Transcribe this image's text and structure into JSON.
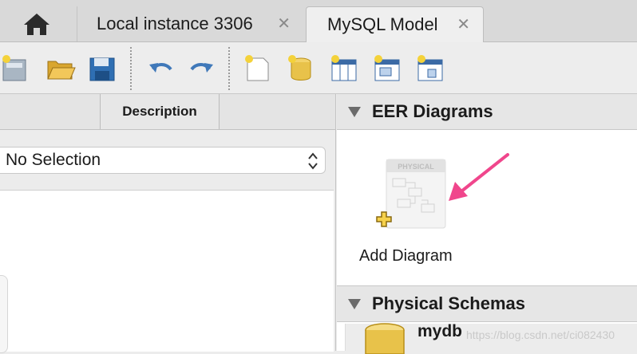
{
  "tabs": [
    {
      "label": "Local instance 3306",
      "close": "✕",
      "active": false
    },
    {
      "label": "MySQL Model",
      "close": "✕",
      "active": true
    }
  ],
  "toolbar": {
    "icons": [
      "new-model-icon",
      "open-model-icon",
      "save-model-icon",
      "undo-icon",
      "redo-icon",
      "new-document-icon",
      "new-schema-icon",
      "new-table-icon",
      "new-view-icon",
      "new-routine-icon"
    ]
  },
  "left_pane": {
    "column_header": "Description",
    "select_value": "No Selection"
  },
  "right_pane": {
    "eer_title": "EER Diagrams",
    "add_diagram_label": "Add Diagram",
    "diagram_badge": "PHYSICAL",
    "physical_title": "Physical Schemas",
    "schema_name": "mydb"
  },
  "watermark": "https://blog.csdn.net/ci082430",
  "colors": {
    "arrow": "#f0468c",
    "db_icon": "#e8c24a"
  }
}
